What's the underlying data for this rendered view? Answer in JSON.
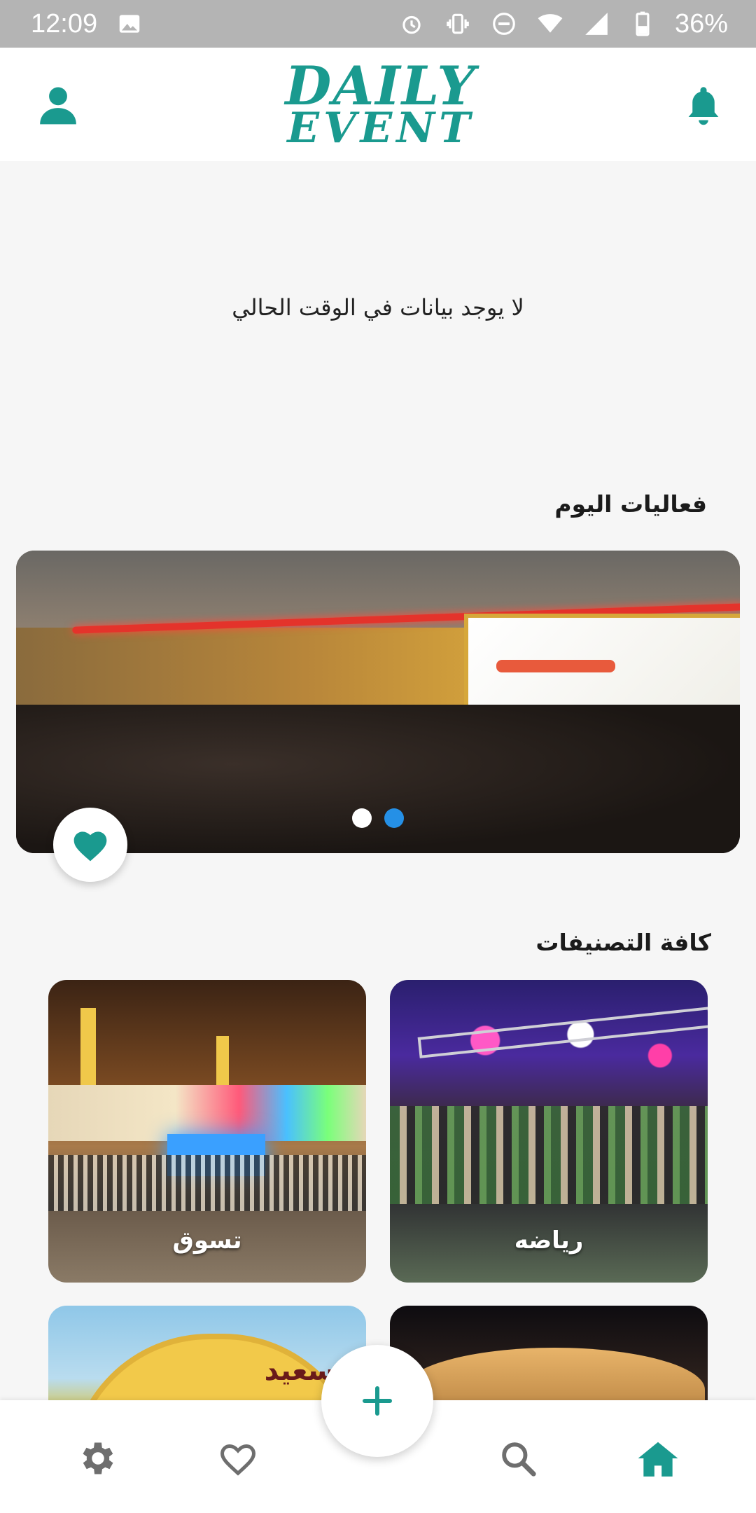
{
  "status_bar": {
    "time": "12:09",
    "battery": "36%",
    "icons": [
      "image-icon",
      "alarm-icon",
      "vibrate-icon",
      "dnd-icon",
      "wifi-icon",
      "signal-icon",
      "battery-icon"
    ]
  },
  "app_bar": {
    "logo_line1": "DAILY",
    "logo_line2": "EVENT",
    "left_icon": "profile-icon",
    "right_icon": "bell-icon"
  },
  "empty_state": {
    "message": "لا يوجد بيانات في الوقت الحالي"
  },
  "today_events": {
    "title": "فعاليات اليوم",
    "carousel_pages": 2,
    "active_page": 2
  },
  "categories": {
    "title": "كافة التصنيفات",
    "items": [
      {
        "label": "رياضه"
      },
      {
        "label": "تسوق"
      },
      {
        "label": ""
      },
      {
        "label": ""
      }
    ],
    "sign_text": "سعيد"
  },
  "bottom_nav": {
    "items": [
      "settings-icon",
      "heart-icon",
      "search-icon",
      "home-icon"
    ],
    "active": "home-icon",
    "fab": "add-icon"
  },
  "colors": {
    "accent": "#1a9a8f",
    "status_bar": "#b4b4b4",
    "dot_active": "#2590e6"
  }
}
